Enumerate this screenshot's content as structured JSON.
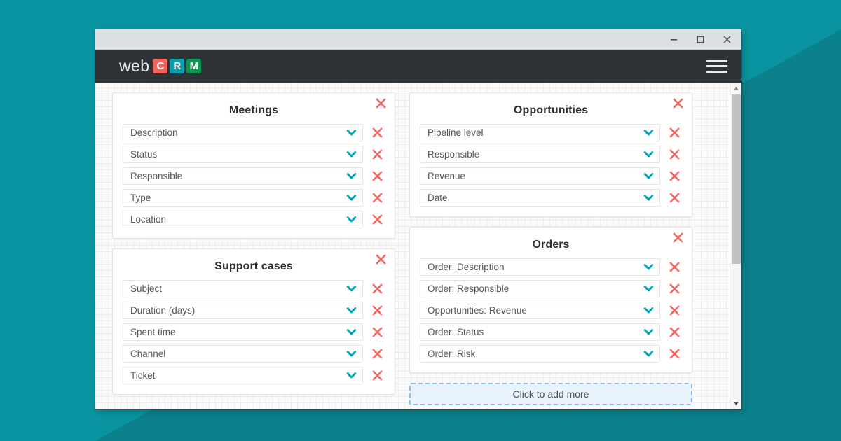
{
  "theme": {
    "background_teal": "#0a94a1",
    "shadow_teal": "#0b818c",
    "navbar_dark": "#2e3338",
    "titlebar_gray": "#dcdfe3",
    "accent_teal": "#00a2b3",
    "delete_red": "#f4645f",
    "add_more_border": "#8fbde8",
    "add_more_fill": "#e9f3fc"
  },
  "titlebar": {
    "minimize_label": "Minimize",
    "maximize_label": "Maximize",
    "close_label": "Close"
  },
  "navbar": {
    "logo": {
      "word": "web",
      "tiles": [
        {
          "letter": "C",
          "color": "#f4645f"
        },
        {
          "letter": "R",
          "color": "#0f9cad"
        },
        {
          "letter": "M",
          "color": "#0e9453"
        }
      ]
    },
    "menu_label": "Menu"
  },
  "panels": [
    {
      "title": "Meetings",
      "close_label": "Remove panel",
      "fields": [
        {
          "label": "Description"
        },
        {
          "label": "Status"
        },
        {
          "label": "Responsible"
        },
        {
          "label": "Type"
        },
        {
          "label": "Location"
        }
      ]
    },
    {
      "title": "Support cases",
      "close_label": "Remove panel",
      "fields": [
        {
          "label": "Subject"
        },
        {
          "label": "Duration (days)"
        },
        {
          "label": "Spent time"
        },
        {
          "label": "Channel"
        },
        {
          "label": "Ticket"
        }
      ]
    },
    {
      "title": "Opportunities",
      "close_label": "Remove panel",
      "fields": [
        {
          "label": "Pipeline level"
        },
        {
          "label": "Responsible"
        },
        {
          "label": "Revenue"
        },
        {
          "label": "Date"
        }
      ]
    },
    {
      "title": "Orders",
      "close_label": "Remove panel",
      "fields": [
        {
          "label": "Order: Description"
        },
        {
          "label": "Order: Responsible"
        },
        {
          "label": "Opportunities: Revenue"
        },
        {
          "label": "Order: Status"
        },
        {
          "label": "Order: Risk"
        }
      ]
    }
  ],
  "add_more": {
    "label": "Click to add more"
  },
  "scrollbar": {
    "up_label": "Scroll up",
    "down_label": "Scroll down"
  }
}
